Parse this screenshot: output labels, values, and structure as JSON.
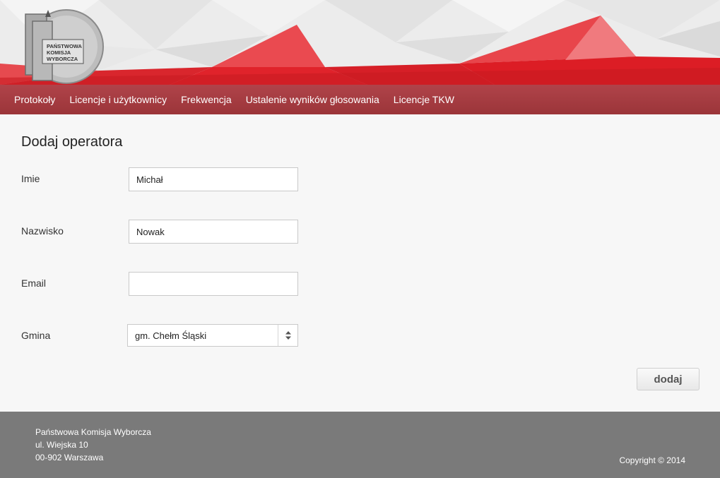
{
  "logo": {
    "lines": [
      "PAŃSTWOWA",
      "KOMISJA",
      "WYBORCZA"
    ]
  },
  "nav": {
    "items": [
      {
        "label": "Protokoły"
      },
      {
        "label": "Licencje i użytkownicy"
      },
      {
        "label": "Frekwencja"
      },
      {
        "label": "Ustalenie wyników głosowania"
      },
      {
        "label": "Licencje TKW"
      }
    ]
  },
  "form": {
    "title": "Dodaj operatora",
    "first_name": {
      "label": "Imie",
      "value": "Michał"
    },
    "last_name": {
      "label": "Nazwisko",
      "value": "Nowak"
    },
    "email": {
      "label": "Email",
      "value": ""
    },
    "municipality": {
      "label": "Gmina",
      "value": "gm. Chełm Śląski"
    },
    "submit_label": "dodaj"
  },
  "footer": {
    "org_name": "Państwowa Komisja Wyborcza",
    "street": "ul. Wiejska 10",
    "city": "00-902 Warszawa",
    "copyright": "Copyright © 2014"
  },
  "colors": {
    "nav_bg": "#a23a40",
    "banner_red": "#e0232b",
    "footer_bg": "#7a7a7a"
  }
}
